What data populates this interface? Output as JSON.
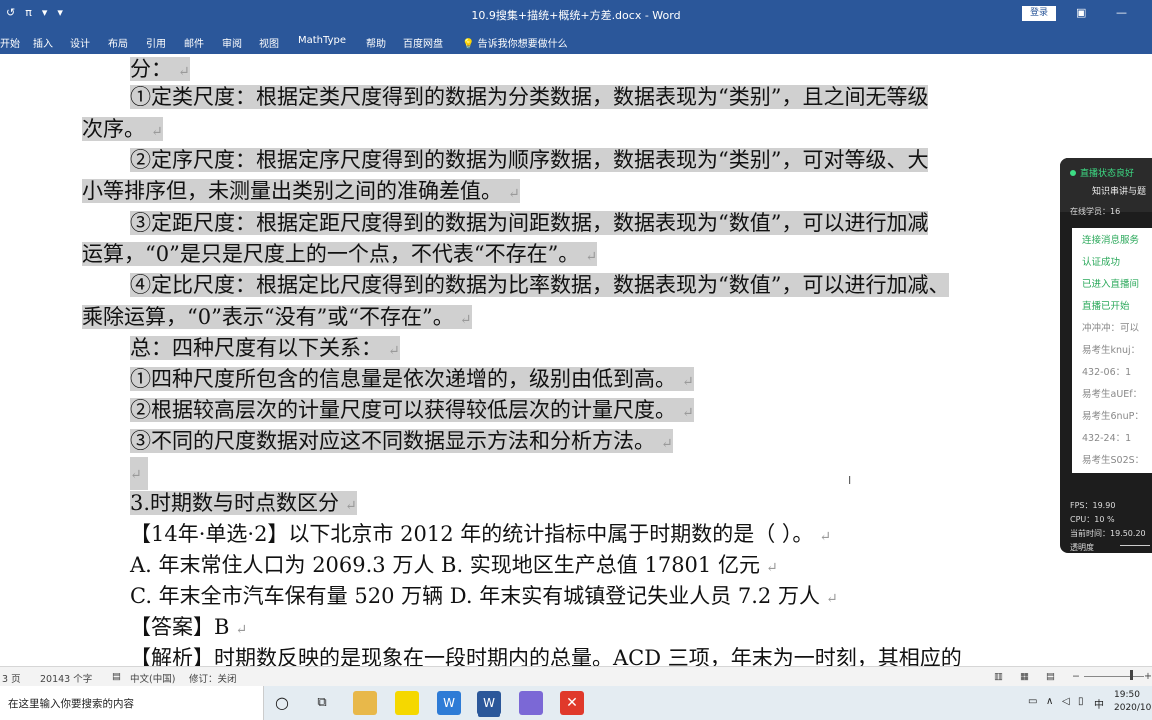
{
  "window": {
    "title": "10.9搜集+描统+概统+方差.docx - Word",
    "login_label": "登录",
    "quick_access": [
      "↺",
      "π",
      "▾",
      "▾"
    ]
  },
  "ribbon": {
    "tabs": [
      "开始",
      "插入",
      "设计",
      "布局",
      "引用",
      "邮件",
      "审阅",
      "视图",
      "MathType",
      "帮助",
      "百度网盘"
    ],
    "tell_me": "告诉我你想要做什么"
  },
  "document": {
    "lines": [
      "分：",
      "①定类尺度：根据定类尺度得到的数据为分类数据，数据表现为“类别”，且之间无等级",
      "次序。",
      "②定序尺度：根据定序尺度得到的数据为顺序数据，数据表现为“类别”，可对等级、大",
      "小等排序但，未测量出类别之间的准确差值。",
      "③定距尺度：根据定距尺度得到的数据为间距数据，数据表现为“数值”，可以进行加减",
      "运算，“0”是只是尺度上的一个点，不代表“不存在”。",
      "④定比尺度：根据定比尺度得到的数据为比率数据，数据表现为“数值”，可以进行加减、",
      "乘除运算，“0”表示“没有”或“不存在”。",
      "总：四种尺度有以下关系：",
      "①四种尺度所包含的信息量是依次递增的，级别由低到高。",
      "②根据较高层次的计量尺度可以获得较低层次的计量尺度。",
      "③不同的尺度数据对应这不同数据显示方法和分析方法。",
      "",
      "3.时期数与时点数区分",
      "【14年·单选·2】以下北京市 2012 年的统计指标中属于时期数的是（    ）。",
      "A. 年末常住人口为 2069.3 万人  B. 实现地区生产总值 17801 亿元",
      "C. 年末全市汽车保有量 520 万辆 D. 年末实有城镇登记失业人员 7.2 万人",
      "【答案】B",
      "【解析】时期数反映的是现象在一段时期内的总量。ACD 三项，年末为一时刻，其相应的"
    ],
    "paragraph_mark": "↵"
  },
  "live_panel": {
    "status": "直播状态良好",
    "subtitle": "知识串讲与题",
    "online": "在线学员：16",
    "messages": [
      {
        "text": "连接消息服务",
        "color": "#2aa85a"
      },
      {
        "text": "认证成功",
        "color": "#2aa85a"
      },
      {
        "text": "已进入直播间",
        "color": "#2aa85a"
      },
      {
        "text": "直播已开始",
        "color": "#2aa85a"
      },
      {
        "text": "冲冲冲：可以",
        "color": "#888888"
      },
      {
        "text": "易考生knuj：",
        "color": "#888888"
      },
      {
        "text": "432-06：1",
        "color": "#888888"
      },
      {
        "text": "易考生aUEf：",
        "color": "#888888"
      },
      {
        "text": "易考生6nuP：",
        "color": "#888888"
      },
      {
        "text": "432-24：1",
        "color": "#888888"
      },
      {
        "text": "易考生S02S：",
        "color": "#888888"
      }
    ],
    "stats": [
      "FPS：19.90",
      "CPU：10 %",
      "当前时间：19.50.20",
      "透明度"
    ]
  },
  "statusbar": {
    "page": "3 页",
    "words": "20143 个字",
    "language": "中文(中国)",
    "track": "修订：关闭",
    "zoom_minus": "−",
    "zoom_plus": "+"
  },
  "taskbar": {
    "search_placeholder": "在这里输入你要搜索的内容",
    "ime": "中",
    "time": "19:50",
    "date": "2020/10"
  },
  "colors": {
    "word_blue": "#2b579a",
    "highlight": "#d0d0d0",
    "panel_bg": "#1d1d1d",
    "live_green": "#3ddc84"
  }
}
